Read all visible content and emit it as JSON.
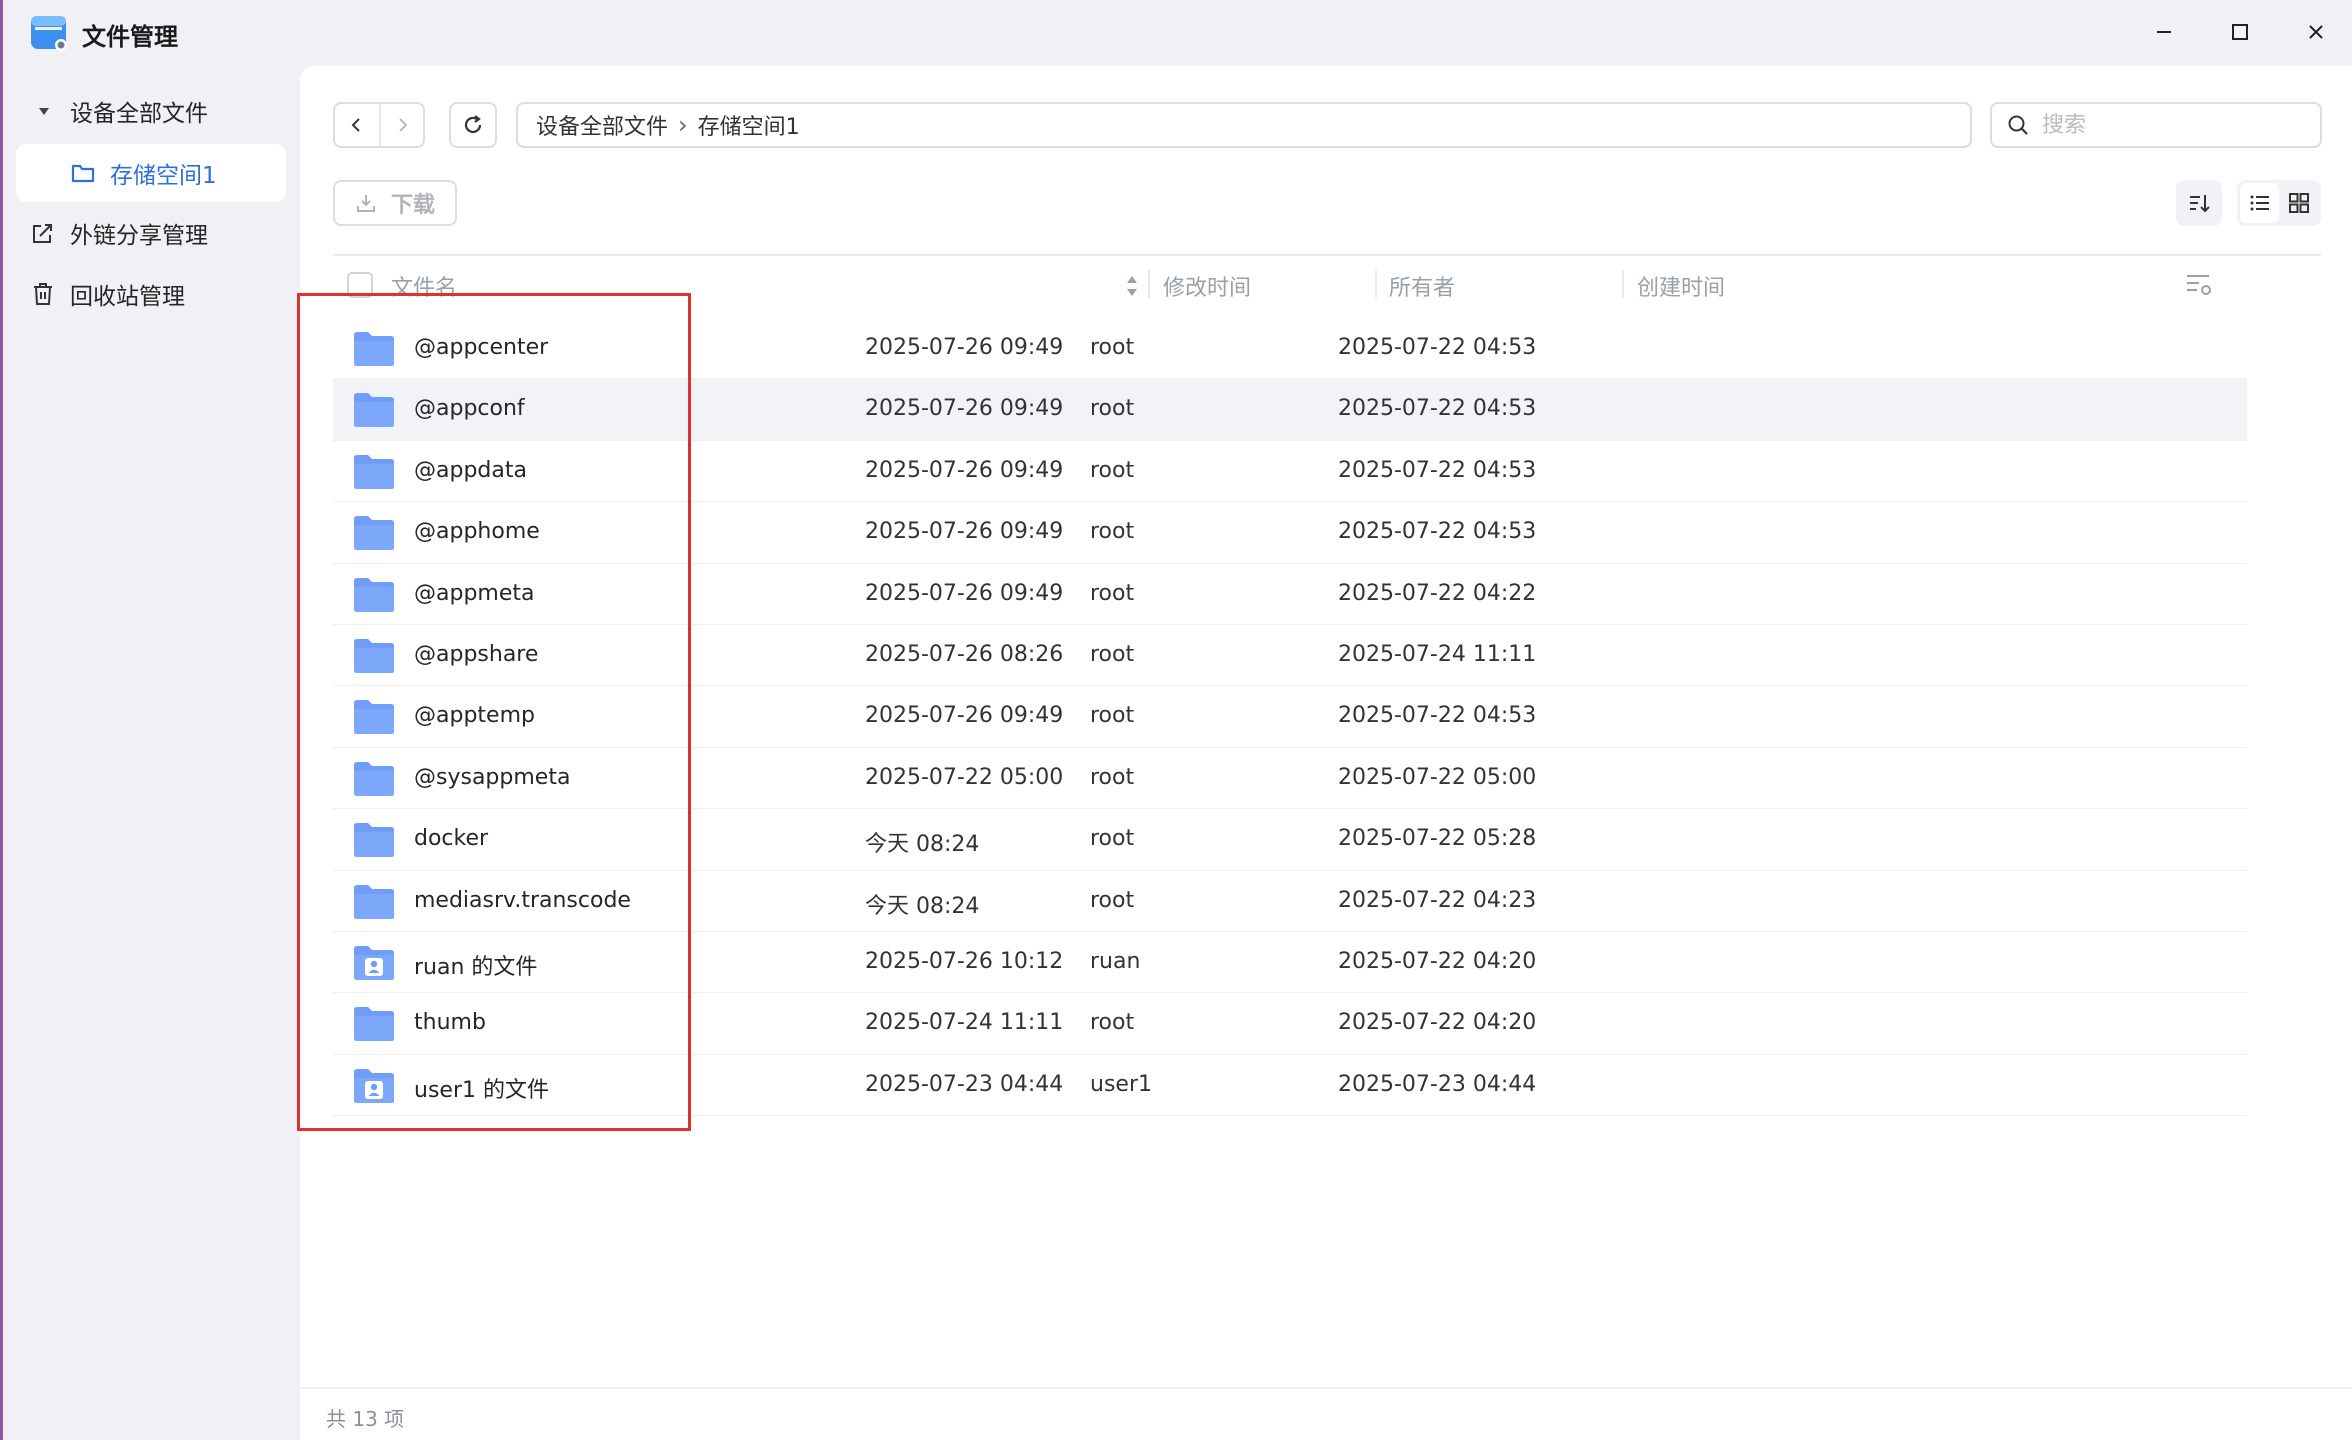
{
  "window": {
    "title": "文件管理"
  },
  "sidebar": {
    "items": [
      {
        "label": "设备全部文件"
      },
      {
        "label": "存储空间1"
      },
      {
        "label": "外链分享管理"
      },
      {
        "label": "回收站管理"
      }
    ]
  },
  "toolbar": {
    "breadcrumb": [
      "设备全部文件",
      "存储空间1"
    ],
    "breadcrumb_separator": "›",
    "search_placeholder": "搜索",
    "download_label": "下载"
  },
  "table": {
    "columns": [
      "文件名",
      "修改时间",
      "所有者",
      "创建时间"
    ],
    "rows": [
      {
        "name": "@appcenter",
        "modified": "2025-07-26 09:49",
        "owner": "root",
        "created": "2025-07-22 04:53",
        "icon": "folder-icon"
      },
      {
        "name": "@appconf",
        "modified": "2025-07-26 09:49",
        "owner": "root",
        "created": "2025-07-22 04:53",
        "icon": "folder-icon"
      },
      {
        "name": "@appdata",
        "modified": "2025-07-26 09:49",
        "owner": "root",
        "created": "2025-07-22 04:53",
        "icon": "folder-icon"
      },
      {
        "name": "@apphome",
        "modified": "2025-07-26 09:49",
        "owner": "root",
        "created": "2025-07-22 04:53",
        "icon": "folder-icon"
      },
      {
        "name": "@appmeta",
        "modified": "2025-07-26 09:49",
        "owner": "root",
        "created": "2025-07-22 04:22",
        "icon": "folder-icon"
      },
      {
        "name": "@appshare",
        "modified": "2025-07-26 08:26",
        "owner": "root",
        "created": "2025-07-24 11:11",
        "icon": "folder-icon"
      },
      {
        "name": "@apptemp",
        "modified": "2025-07-26 09:49",
        "owner": "root",
        "created": "2025-07-22 04:53",
        "icon": "folder-icon"
      },
      {
        "name": "@sysappmeta",
        "modified": "2025-07-22 05:00",
        "owner": "root",
        "created": "2025-07-22 05:00",
        "icon": "folder-icon"
      },
      {
        "name": "docker",
        "modified": "今天 08:24",
        "owner": "root",
        "created": "2025-07-22 05:28",
        "icon": "folder-icon"
      },
      {
        "name": "mediasrv.transcode",
        "modified": "今天 08:24",
        "owner": "root",
        "created": "2025-07-22 04:23",
        "icon": "folder-icon"
      },
      {
        "name": "ruan 的文件",
        "modified": "2025-07-26 10:12",
        "owner": "ruan",
        "created": "2025-07-22 04:20",
        "icon": "user-folder-icon"
      },
      {
        "name": "thumb",
        "modified": "2025-07-24 11:11",
        "owner": "root",
        "created": "2025-07-22 04:20",
        "icon": "folder-icon"
      },
      {
        "name": "user1 的文件",
        "modified": "2025-07-23 04:44",
        "owner": "user1",
        "created": "2025-07-23 04:44",
        "icon": "user-folder-icon"
      }
    ]
  },
  "footer": {
    "count_text": "共 13 项"
  },
  "colors": {
    "accent": "#2f6fdc",
    "folder": "#6f9df7",
    "highlight": "#e03131"
  }
}
